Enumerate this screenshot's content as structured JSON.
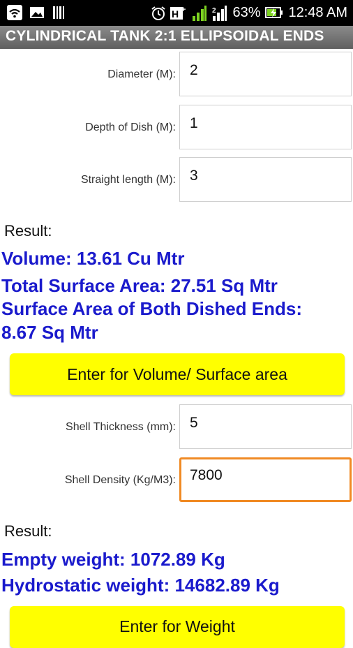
{
  "status": {
    "battery": "63%",
    "time": "12:48 AM",
    "network": "H+"
  },
  "app": {
    "title": "CYLINDRICAL TANK 2:1 ELLIPSOIDAL ENDS"
  },
  "inputs1": [
    {
      "label": "Diameter (M):",
      "value": "2"
    },
    {
      "label": "Depth of Dish (M):",
      "value": "1"
    },
    {
      "label": "Straight length (M):",
      "value": "3"
    }
  ],
  "result1": {
    "label": "Result:",
    "lines": [
      "Volume:  13.61  Cu Mtr",
      "Total Surface Area:  27.51  Sq Mtr",
      "Surface Area of Both Dished Ends:",
      "8.67  Sq Mtr"
    ]
  },
  "button1": {
    "label": "Enter for Volume/ Surface area"
  },
  "inputs2": [
    {
      "label": "Shell Thickness (mm):",
      "value": "5"
    },
    {
      "label": "Shell Density (Kg/M3):",
      "value": "7800"
    }
  ],
  "result2": {
    "label": "Result:",
    "lines": [
      "Empty weight:  1072.89  Kg",
      "Hydrostatic weight:  14682.89  Kg"
    ]
  },
  "button2": {
    "label": "Enter for Weight"
  },
  "colors": {
    "result_text": "#1a1acc",
    "button_bg": "#ffff00",
    "focus_border": "#f08a24",
    "battery_green": "#7ed321"
  }
}
